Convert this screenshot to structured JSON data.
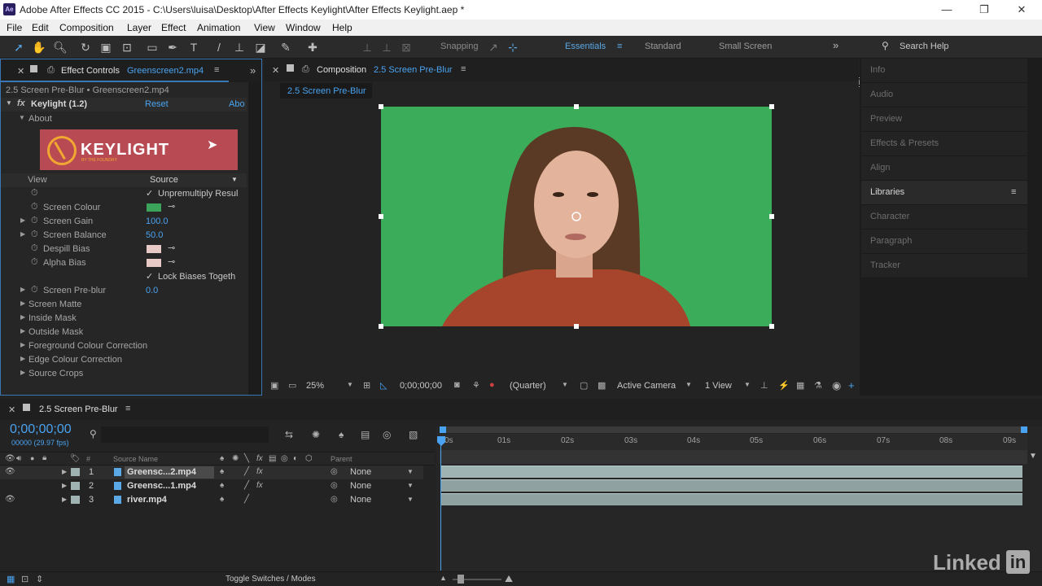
{
  "window": {
    "app_badge": "Ae",
    "title": "Adobe After Effects CC 2015 - C:\\Users\\luisa\\Desktop\\After Effects Keylight\\After Effects Keylight.aep *",
    "minimize": "—",
    "restore": "❐",
    "close": "✕"
  },
  "menu": [
    "File",
    "Edit",
    "Composition",
    "Layer",
    "Effect",
    "Animation",
    "View",
    "Window",
    "Help"
  ],
  "toolbar": {
    "snapping": "Snapping",
    "workspaces": [
      "Essentials",
      "Standard",
      "Small Screen"
    ],
    "overflow": "»",
    "search_help": "Search Help"
  },
  "effect_controls": {
    "tab_label": "Effect Controls",
    "tab_file": "Greenscreen2.mp4",
    "breadcrumb": "2.5 Screen Pre-Blur • Greenscreen2.mp4",
    "effect_name": "Keylight (1.2)",
    "reset": "Reset",
    "about_link": "Abo",
    "about_section": "About",
    "logo_text": "KEYLIGHT",
    "logo_sub": "BY THE FOUNDRY",
    "view_label": "View",
    "view_value": "Source",
    "unpremultiply": "Unpremultiply Resul",
    "screen_colour": "Screen Colour",
    "screen_colour_hex": "#3ca35a",
    "screen_gain": "Screen Gain",
    "screen_gain_value": "100.0",
    "screen_balance": "Screen Balance",
    "screen_balance_value": "50.0",
    "despill_bias": "Despill Bias",
    "alpha_bias": "Alpha Bias",
    "bias_swatch_hex": "#e7c9c6",
    "lock_biases": "Lock Biases Togeth",
    "screen_preblur": "Screen Pre-blur",
    "screen_preblur_value": "0.0",
    "groups": [
      "Screen Matte",
      "Inside Mask",
      "Outside Mask",
      "Foreground Colour Correction",
      "Edge Colour Correction",
      "Source Crops"
    ]
  },
  "composition": {
    "tab_label": "Composition",
    "tab_name": "2.5 Screen Pre-Blur",
    "flow_tab": "2.5 Screen Pre-Blur",
    "zoom": "25%",
    "timecode": "0;00;00;00",
    "resolution": "(Quarter)",
    "camera": "Active Camera",
    "views": "1 View"
  },
  "right_panels": [
    "Info",
    "Audio",
    "Preview",
    "Effects & Presets",
    "Align",
    "Libraries",
    "Character",
    "Paragraph",
    "Tracker"
  ],
  "timeline": {
    "comp_name": "2.5 Screen Pre-Blur",
    "timecode": "0;00;00;00",
    "frame_info": "00000 (29.97 fps)",
    "search_placeholder": "",
    "col_source": "Source Name",
    "col_parent": "Parent",
    "layers": [
      {
        "num": "1",
        "name": "Greensc...2.mp4",
        "parent": "None"
      },
      {
        "num": "2",
        "name": "Greensc...1.mp4",
        "parent": "None"
      },
      {
        "num": "3",
        "name": "river.mp4",
        "parent": "None"
      }
    ],
    "ruler": [
      "0s",
      "01s",
      "02s",
      "03s",
      "04s",
      "05s",
      "06s",
      "07s",
      "08s",
      "09s"
    ],
    "toggle": "Toggle Switches / Modes"
  },
  "watermark": {
    "linked": "Linked",
    "in": "in"
  },
  "colors": {
    "accent": "#4aa3f0",
    "green_screen": "#3fb25e",
    "layer_bar": "#9fb3b3"
  }
}
